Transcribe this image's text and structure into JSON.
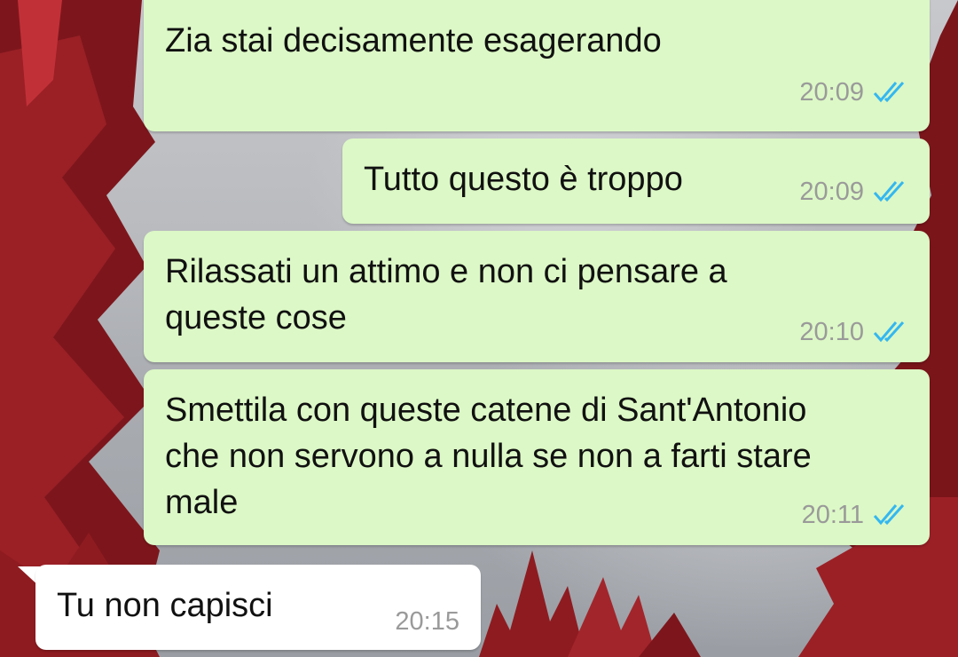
{
  "messages": [
    {
      "direction": "outgoing",
      "text": "Zia stai decisamente esagerando",
      "time": "20:09",
      "status_icon": "read-double-check-icon"
    },
    {
      "direction": "outgoing",
      "text": "Tutto questo è troppo",
      "time": "20:09",
      "status_icon": "read-double-check-icon"
    },
    {
      "direction": "outgoing",
      "text": "Rilassati un attimo e non ci pensare a\nqueste cose",
      "time": "20:10",
      "status_icon": "read-double-check-icon"
    },
    {
      "direction": "outgoing",
      "text": "Smettila con queste catene di Sant'Antonio\nche non servono a nulla se non a farti stare\nmale",
      "time": "20:11",
      "status_icon": "read-double-check-icon"
    },
    {
      "direction": "incoming",
      "text": "Tu non capisci",
      "time": "20:15"
    }
  ],
  "colors": {
    "outgoing_bubble": "#dcf8c6",
    "incoming_bubble": "#ffffff",
    "read_ticks": "#34b7f1",
    "timestamp": "#9a9a9a",
    "wallpaper_trees": "#8e1b20"
  }
}
